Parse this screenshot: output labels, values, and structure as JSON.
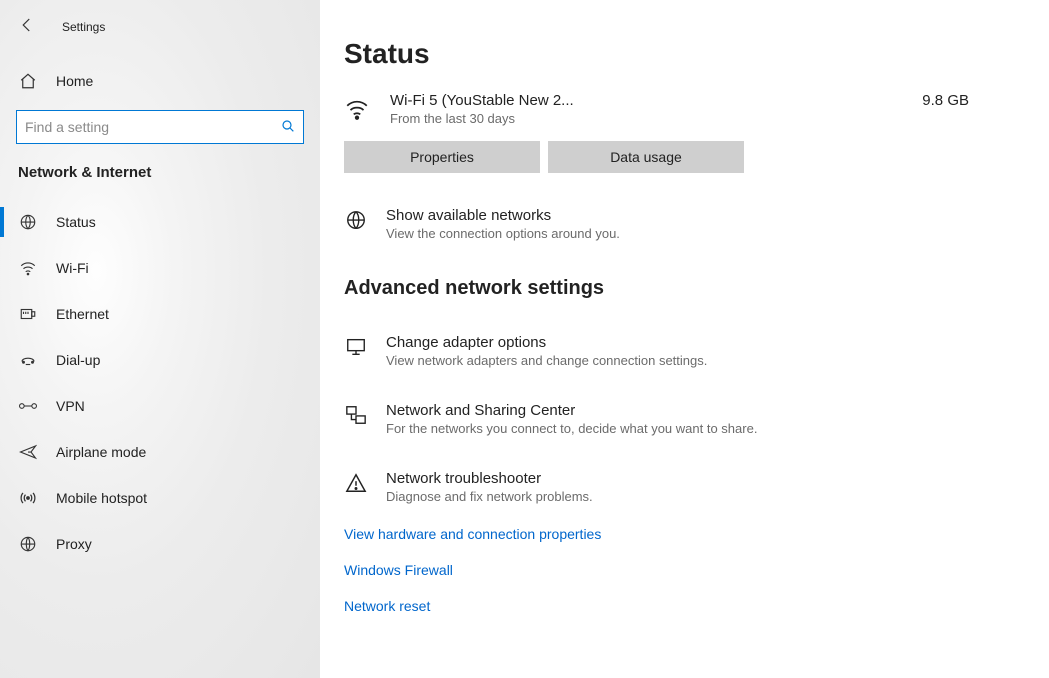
{
  "app": {
    "title": "Settings"
  },
  "sidebar": {
    "home": "Home",
    "search_placeholder": "Find a setting",
    "section": "Network & Internet",
    "items": [
      {
        "label": "Status"
      },
      {
        "label": "Wi-Fi"
      },
      {
        "label": "Ethernet"
      },
      {
        "label": "Dial-up"
      },
      {
        "label": "VPN"
      },
      {
        "label": "Airplane mode"
      },
      {
        "label": "Mobile hotspot"
      },
      {
        "label": "Proxy"
      }
    ]
  },
  "main": {
    "title": "Status",
    "connection": {
      "name": "Wi-Fi 5 (YouStable New 2...",
      "subtitle": "From the last 30 days",
      "usage": "9.8 GB"
    },
    "buttons": {
      "properties": "Properties",
      "data_usage": "Data usage"
    },
    "show_networks": {
      "title": "Show available networks",
      "subtitle": "View the connection options around you."
    },
    "advanced_heading": "Advanced network settings",
    "adapter": {
      "title": "Change adapter options",
      "subtitle": "View network adapters and change connection settings."
    },
    "sharing": {
      "title": "Network and Sharing Center",
      "subtitle": "For the networks you connect to, decide what you want to share."
    },
    "troubleshoot": {
      "title": "Network troubleshooter",
      "subtitle": "Diagnose and fix network problems."
    },
    "links": {
      "hardware": "View hardware and connection properties",
      "firewall": "Windows Firewall",
      "reset": "Network reset"
    }
  }
}
